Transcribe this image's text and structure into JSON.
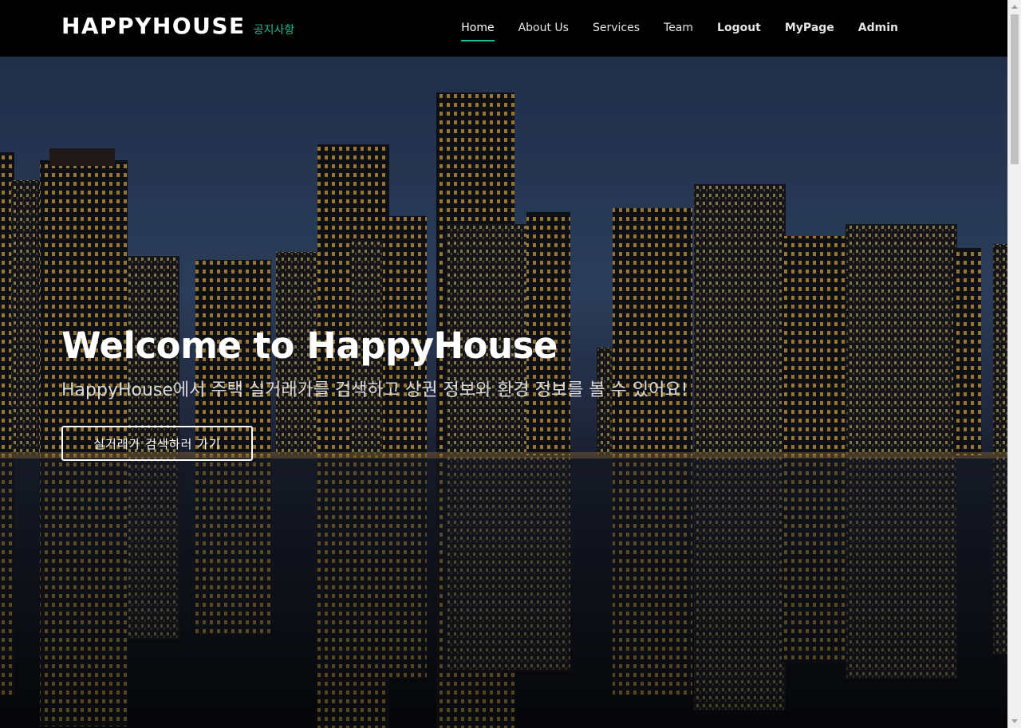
{
  "header": {
    "logo": "HAPPYHOUSE",
    "notice_link": "공지사항",
    "nav": [
      {
        "label": "Home",
        "active": true
      },
      {
        "label": "About Us"
      },
      {
        "label": "Services"
      },
      {
        "label": "Team"
      },
      {
        "label": "Logout"
      },
      {
        "label": "MyPage"
      },
      {
        "label": "Admin"
      }
    ]
  },
  "hero": {
    "title": "Welcome to HappyHouse",
    "subtitle": "HappyHouse에서 주택 실거래가를 검색하고 상권 정보와 환경 정보를 볼 수 있어요!",
    "button_label": "실거래가 검색하러 가기",
    "background_image": "night city skyline reflected in water"
  },
  "colors": {
    "accent": "#1bbd96",
    "header_bg": "#000000",
    "text_light": "#ffffff"
  }
}
